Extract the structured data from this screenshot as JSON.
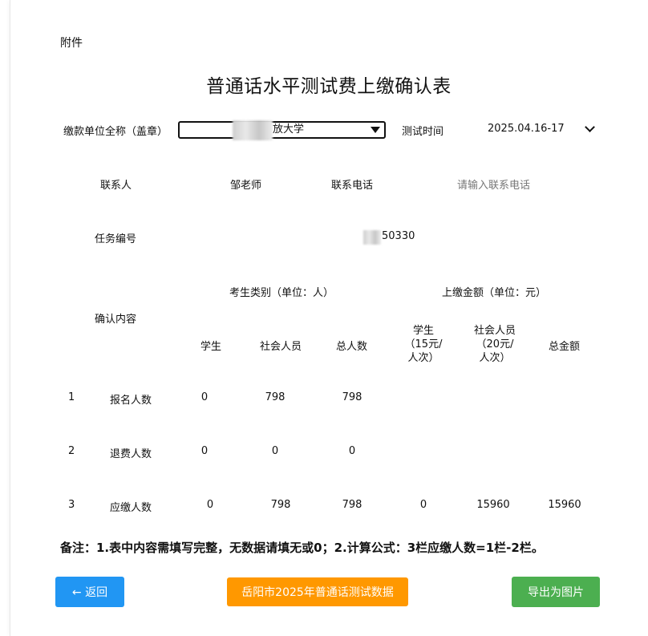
{
  "attachment_label": "附件",
  "title": "普通话水平测试费上缴确认表",
  "payer": {
    "label": "缴款单位全称（盖章）",
    "selected_value": "放大学"
  },
  "test_time": {
    "label": "测试时间",
    "value": "2025.04.16-17"
  },
  "contact": {
    "label": "联系人",
    "value": "邹老师",
    "phone_label": "联系电话",
    "phone_placeholder": "请输入联系电话"
  },
  "task": {
    "label": "任务编号",
    "value": "50330"
  },
  "table": {
    "confirm_label": "确认内容",
    "group_candidates": "考生类别（单位：人）",
    "group_amount": "上缴金额（单位：元）",
    "headers": {
      "student": "学生",
      "social": "社会人员",
      "total_people": "总人数",
      "student_fee": "学生（15元/人次）",
      "social_fee": "社会人员（20元/人次）",
      "total_amount": "总金额"
    },
    "rows": [
      {
        "no": "1",
        "name": "报名人数",
        "student": "0",
        "social": "798",
        "total": "798",
        "student_fee": "",
        "social_fee": "",
        "total_amount": ""
      },
      {
        "no": "2",
        "name": "退费人数",
        "student": "0",
        "social": "0",
        "total": "0",
        "student_fee": "",
        "social_fee": "",
        "total_amount": ""
      },
      {
        "no": "3",
        "name": "应缴人数",
        "student": "0",
        "social": "798",
        "total": "798",
        "student_fee": "0",
        "social_fee": "15960",
        "total_amount": "15960"
      }
    ]
  },
  "note": "备注：1.表中内容需填写完整，无数据请填无或0；2.计算公式：3栏应缴人数=1栏-2栏。",
  "buttons": {
    "back": "← 返回",
    "data": "岳阳市2025年普通话测试数据",
    "export": "导出为图片"
  },
  "colors": {
    "back_button": "#2196f3",
    "data_button": "#ff9800",
    "export_button": "#4caf50"
  }
}
